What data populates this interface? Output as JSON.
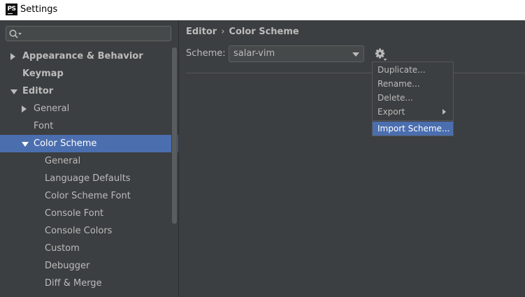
{
  "window": {
    "title": "Settings",
    "app_icon_text": "PS"
  },
  "colors": {
    "background": "#3c3f41",
    "selection": "#4b6eaf",
    "text": "#bbbbbb",
    "titlebar": "#ffffff"
  },
  "sidebar": {
    "search": {
      "icon": "search-icon",
      "value": "",
      "placeholder": ""
    },
    "tree": [
      {
        "label": "Appearance & Behavior",
        "level": 0,
        "bold": true,
        "expander": "collapsed",
        "selected": false
      },
      {
        "label": "Keymap",
        "level": 0,
        "bold": true,
        "expander": "none",
        "selected": false
      },
      {
        "label": "Editor",
        "level": 0,
        "bold": true,
        "expander": "expanded",
        "selected": false
      },
      {
        "label": "General",
        "level": 1,
        "bold": false,
        "expander": "collapsed",
        "selected": false
      },
      {
        "label": "Font",
        "level": 1,
        "bold": false,
        "expander": "none",
        "selected": false
      },
      {
        "label": "Color Scheme",
        "level": 1,
        "bold": false,
        "expander": "expanded",
        "selected": true
      },
      {
        "label": "General",
        "level": 2,
        "bold": false,
        "expander": "none",
        "selected": false
      },
      {
        "label": "Language Defaults",
        "level": 2,
        "bold": false,
        "expander": "none",
        "selected": false
      },
      {
        "label": "Color Scheme Font",
        "level": 2,
        "bold": false,
        "expander": "none",
        "selected": false
      },
      {
        "label": "Console Font",
        "level": 2,
        "bold": false,
        "expander": "none",
        "selected": false
      },
      {
        "label": "Console Colors",
        "level": 2,
        "bold": false,
        "expander": "none",
        "selected": false
      },
      {
        "label": "Custom",
        "level": 2,
        "bold": false,
        "expander": "none",
        "selected": false
      },
      {
        "label": "Debugger",
        "level": 2,
        "bold": false,
        "expander": "none",
        "selected": false
      },
      {
        "label": "Diff & Merge",
        "level": 2,
        "bold": false,
        "expander": "none",
        "selected": false
      }
    ]
  },
  "main": {
    "breadcrumb": {
      "items": [
        "Editor",
        "Color Scheme"
      ],
      "separator": "›"
    },
    "scheme": {
      "label": "Scheme:",
      "value": "salar-vim"
    },
    "gear_icon": "gear-icon"
  },
  "gear_menu": {
    "items": [
      {
        "label": "Duplicate...",
        "has_submenu": false,
        "highlighted": false
      },
      {
        "label": "Rename...",
        "has_submenu": false,
        "highlighted": false
      },
      {
        "label": "Delete...",
        "has_submenu": false,
        "highlighted": false
      },
      {
        "label": "Export",
        "has_submenu": true,
        "highlighted": false
      },
      {
        "label": "Import Scheme...",
        "has_submenu": false,
        "highlighted": true
      }
    ]
  }
}
